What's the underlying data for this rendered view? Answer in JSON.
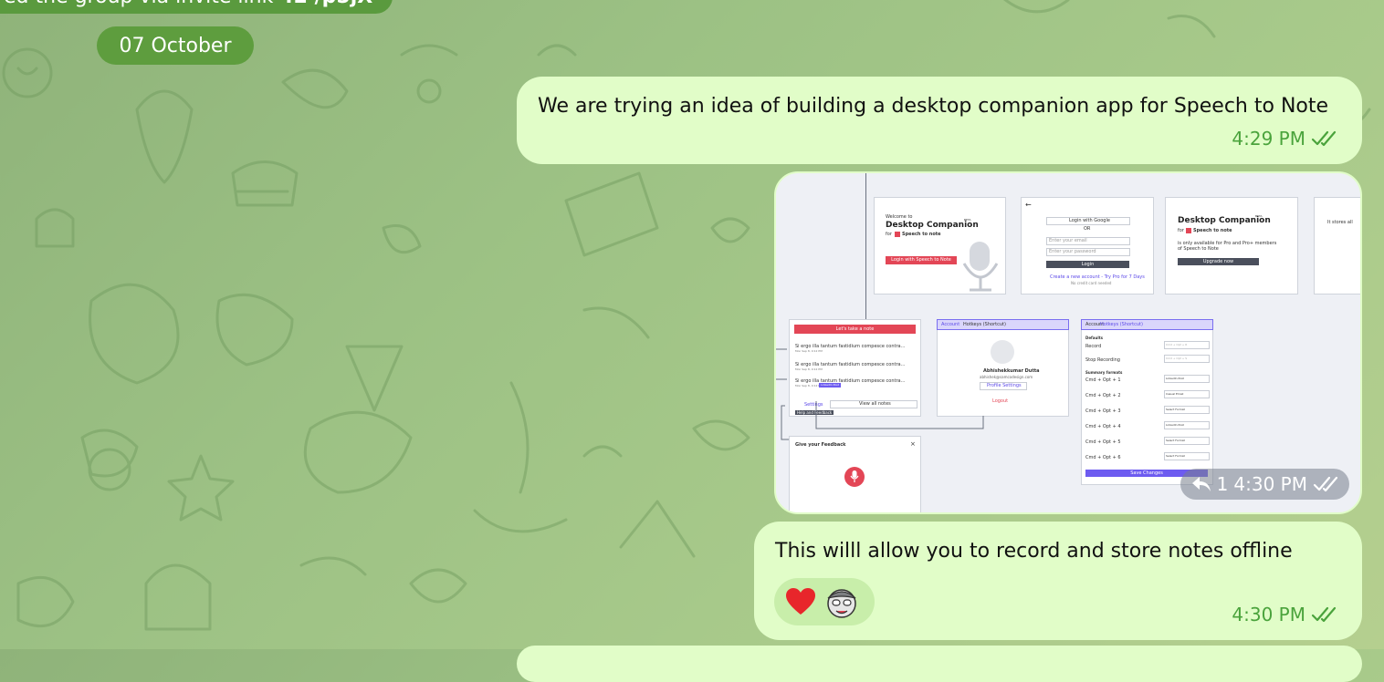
{
  "system_message": {
    "text": "ed the group via invite link",
    "bold": "42 /p5jX"
  },
  "date_separator": "07 October",
  "messages": [
    {
      "text": "We are trying an idea of building a desktop companion app for Speech to Note",
      "time": "4:29 PM"
    },
    {
      "type": "image",
      "replies": "1",
      "time": "4:30 PM"
    },
    {
      "text": "This willl allow you to record and store notes offline",
      "time": "4:30 PM",
      "reactions": [
        "heart",
        "cartoon-avatar"
      ]
    }
  ],
  "screenshot": {
    "welcome": "Welcome to",
    "app_title": "Desktop Companion",
    "beta": "BETA",
    "for": "for",
    "brand": "Speech to note",
    "login_with_account": "Login with Speech to Note Account",
    "login_google": "Login with Google",
    "or": "OR",
    "email_placeholder": "Enter your email",
    "password_placeholder": "Enter your password",
    "login": "Login",
    "create_account": "Create a new account - Try Pro for 7 Days",
    "no_card": "No credit card needed",
    "pro_only_1": "is only available for Pro and Pro+ members",
    "pro_only_2": "of Speech to Note",
    "upgrade": "Upgrade now",
    "stores": "It stores all",
    "lets_take_note": "Let's take a note",
    "note_line": "Si ergo illa tantum fastidium compesce contra...",
    "note_date": "Mon Sep 8, 9:12 PM",
    "linkedin_tag": "LinkedIn Post",
    "settings": "Settings",
    "view_all": "View all notes",
    "help_feedback": "Help and Feedback",
    "tab_account": "Account",
    "tab_hotkeys": "Hotkeys (Shortcut)",
    "user_name": "Abhishekkumar Dutta",
    "user_email": "abhishek@samcodesign.com",
    "profile_settings": "Profile Settings",
    "logout": "Logout",
    "defaults": "Defaults",
    "record": "Record",
    "stop_recording": "Stop Recording",
    "summary_formats": "Summary formats",
    "hotkey_record": "Cmd + Opt + R",
    "hotkey_stop": "Cmd + Opt + S",
    "shortcuts": [
      {
        "key": "Cmd + Opt + 1",
        "value": "LinkedIn Post"
      },
      {
        "key": "Cmd + Opt + 2",
        "value": "Casual Email"
      },
      {
        "key": "Cmd + Opt + 3",
        "value": "Select Format"
      },
      {
        "key": "Cmd + Opt + 4",
        "value": "LinkedIn Post"
      },
      {
        "key": "Cmd + Opt + 5",
        "value": "Select Format"
      },
      {
        "key": "Cmd + Opt + 6",
        "value": "Select Format"
      }
    ],
    "save_changes": "Save Changes",
    "give_feedback": "Give your Feedback"
  },
  "colors": {
    "bubble": "#e1fdc8",
    "accent_green": "#4aa33c",
    "date_pill": "#5e9d3e"
  }
}
